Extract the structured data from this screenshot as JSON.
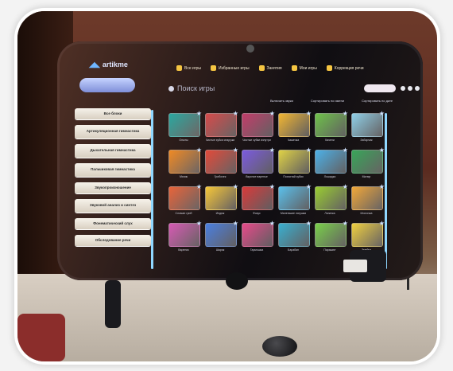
{
  "app": {
    "logo_text": "artikme"
  },
  "tabs": [
    "Все игры",
    "Избранные игры",
    "Занятия",
    "Мои игры",
    "Коррекция речи"
  ],
  "search": {
    "placeholder": "Поиск игры"
  },
  "toolbar2": [
    "Включить звуки",
    "Сортировать по имени",
    "Сортировать по дате"
  ],
  "menu": [
    "Все блоки",
    "Артикуляционная гимнастика",
    "Дыхательная гимнастика",
    "Пальчиковая гимнастика",
    "Звукопроизношение",
    "Звуковой анализ и синтез",
    "Фонематический слух",
    "Обследование речи"
  ],
  "games": [
    {
      "caption": "Опыты",
      "color": "#2aa8a0"
    },
    {
      "caption": "Чистые зубки снаружи",
      "color": "#d64b4b"
    },
    {
      "caption": "Чистые зубки изнутри",
      "color": "#c23d6a"
    },
    {
      "caption": "Чашечка",
      "color": "#f2b632"
    },
    {
      "caption": "Качели",
      "color": "#6fc24a"
    },
    {
      "caption": "Заборчик",
      "color": "#8fd0e8"
    },
    {
      "caption": "Мячик",
      "color": "#f08a24"
    },
    {
      "caption": "Грибочек",
      "color": "#e34a3a"
    },
    {
      "caption": "Вкусное варенье",
      "color": "#7b5be0"
    },
    {
      "caption": "Посчитай зубки",
      "color": "#e0d246"
    },
    {
      "caption": "Лошадка",
      "color": "#4db1e8"
    },
    {
      "caption": "Маляр",
      "color": "#39a65a"
    },
    {
      "caption": "Сломан гриб",
      "color": "#e8643a"
    },
    {
      "caption": "Индюк",
      "color": "#f6c739"
    },
    {
      "caption": "Фокус",
      "color": "#d93a3a"
    },
    {
      "caption": "Маленькие лягушки",
      "color": "#5bc0eb"
    },
    {
      "caption": "Лопатка",
      "color": "#9acd32"
    },
    {
      "caption": "Иголочка",
      "color": "#f2a83a"
    },
    {
      "caption": "Вареник",
      "color": "#d65ab4"
    },
    {
      "caption": "Шарик",
      "color": "#4a7fe0"
    },
    {
      "caption": "Гармошка",
      "color": "#e84a8a"
    },
    {
      "caption": "Барабан",
      "color": "#3ab0d0"
    },
    {
      "caption": "Парашют",
      "color": "#7ad04a"
    },
    {
      "caption": "Змейка",
      "color": "#f0d040"
    }
  ]
}
